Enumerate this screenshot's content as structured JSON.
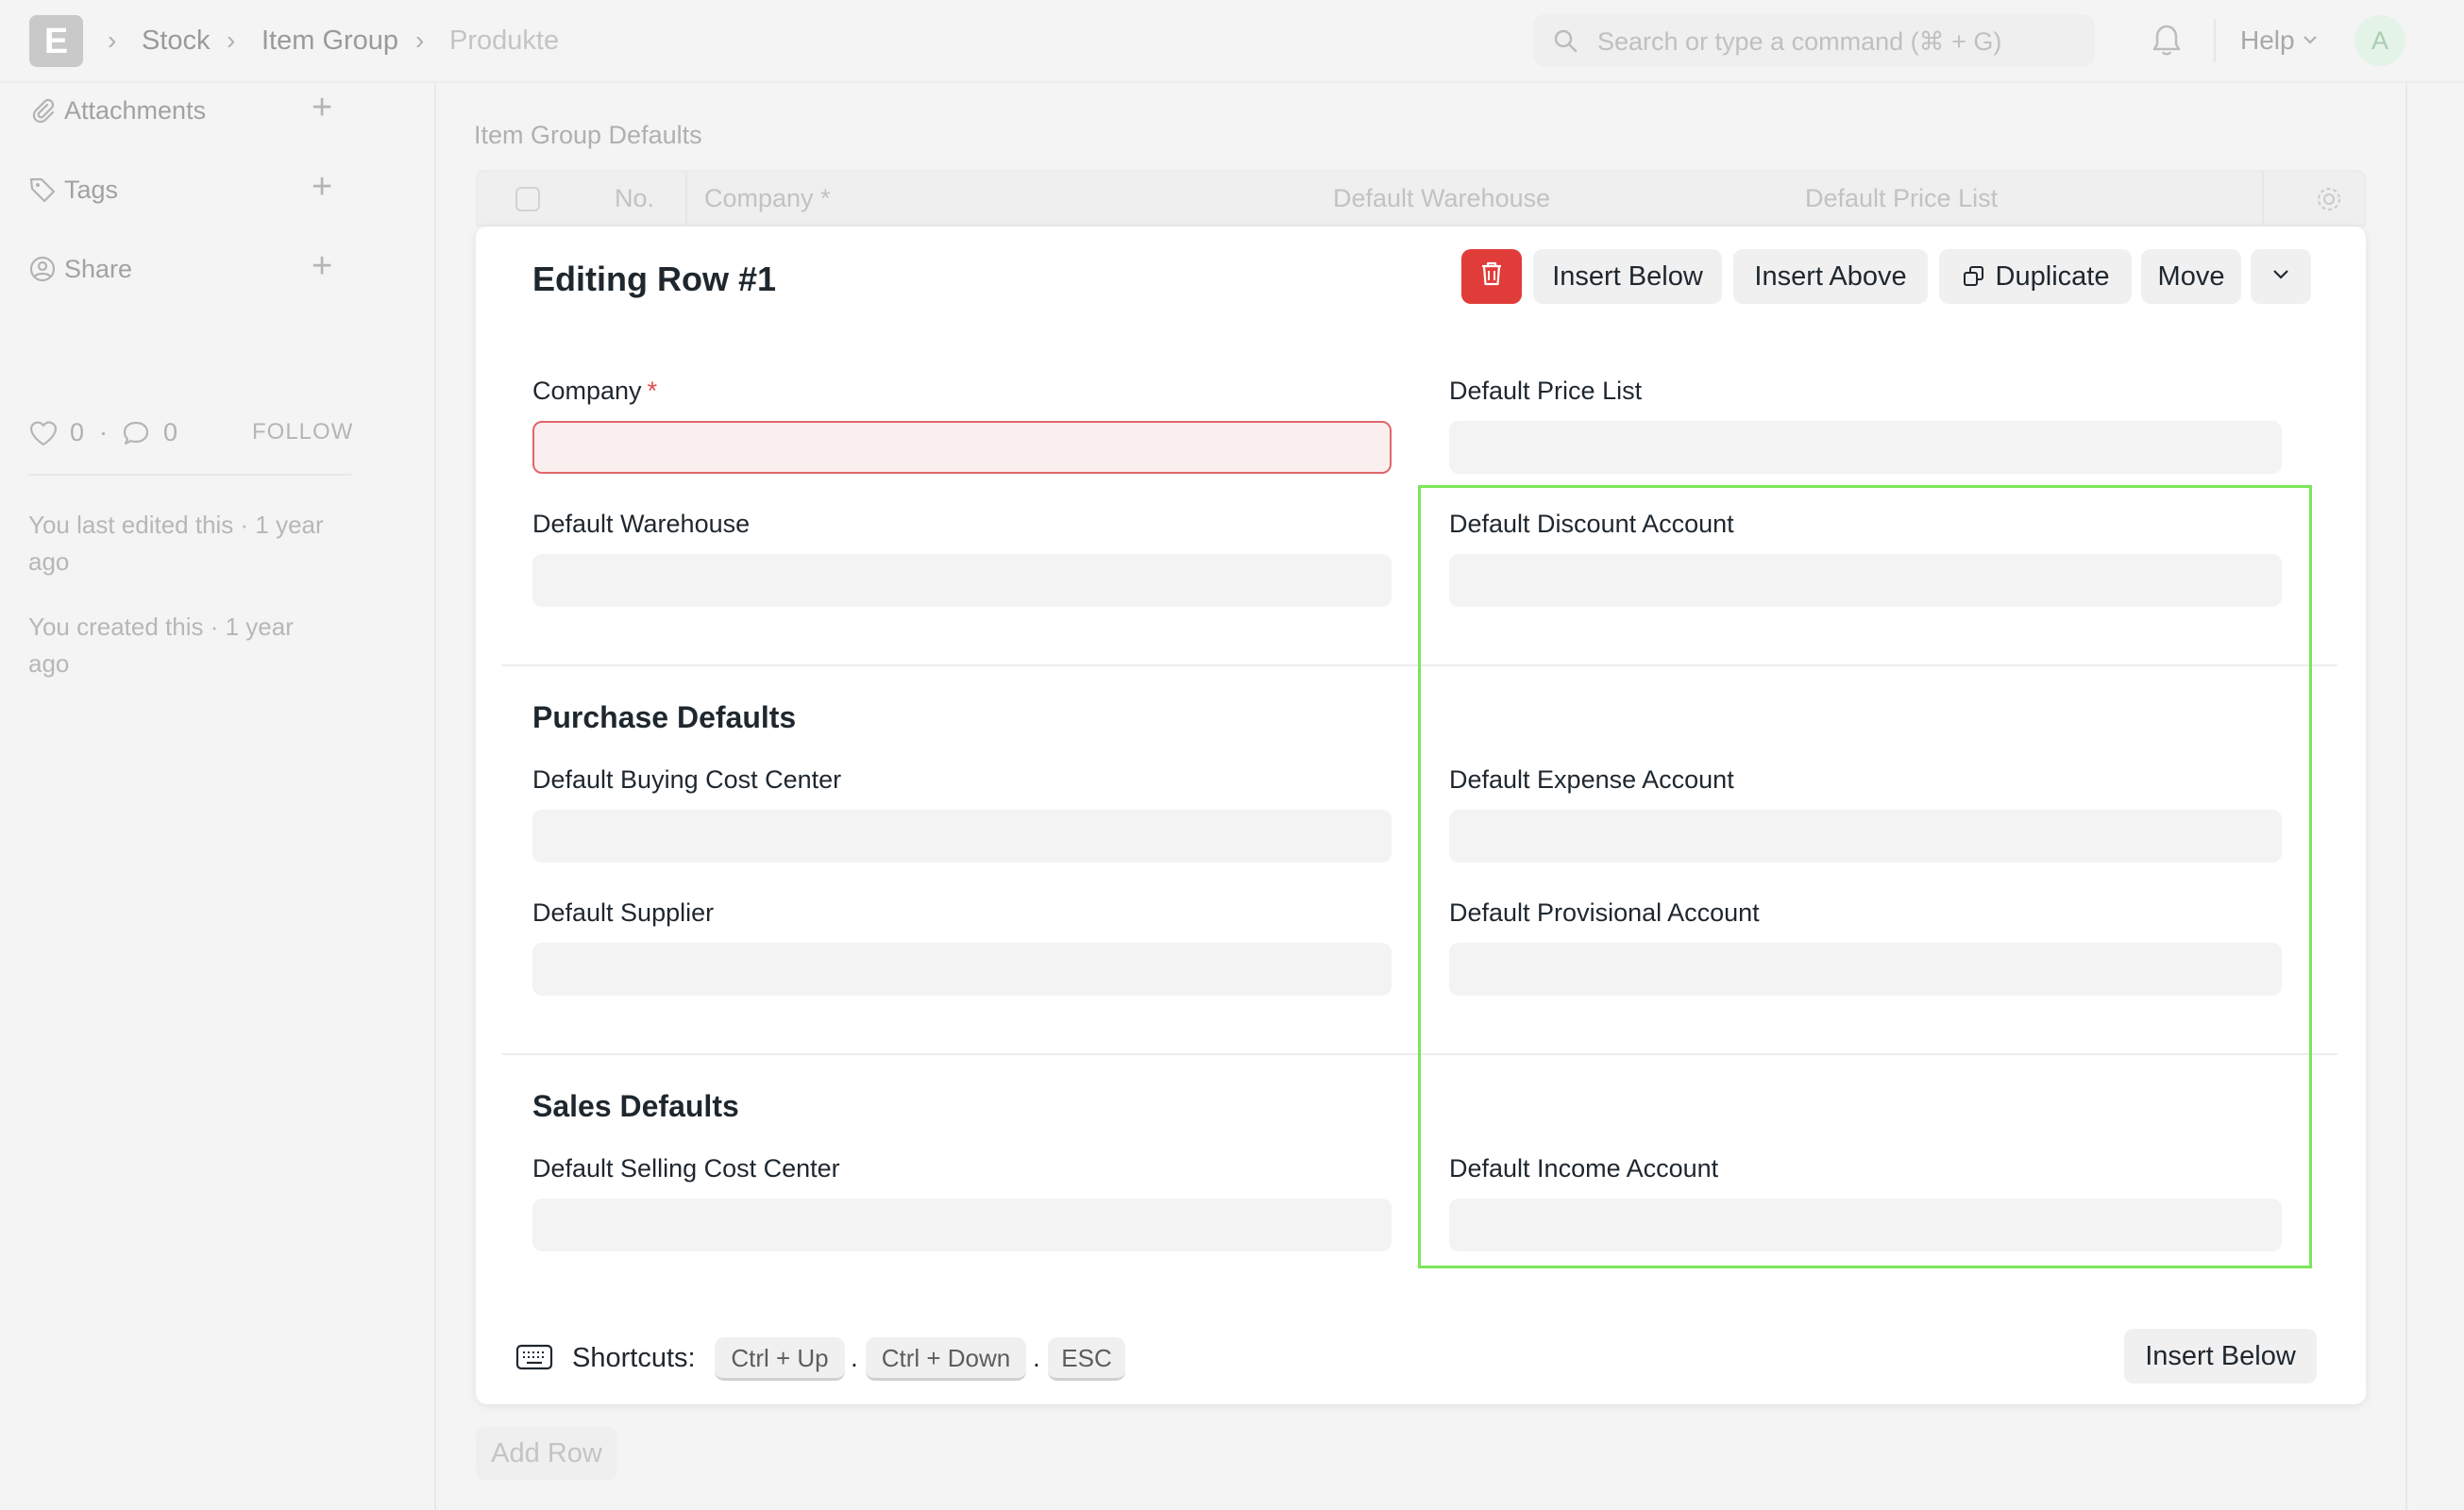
{
  "navbar": {
    "logo_letter": "E",
    "breadcrumbs": [
      "Stock",
      "Item Group",
      "Produkte"
    ],
    "search_placeholder": "Search or type a command (⌘ + G)",
    "help_label": "Help",
    "avatar_letter": "A"
  },
  "sidebar": {
    "items": [
      {
        "label": "Attachments",
        "icon": "paperclip-icon"
      },
      {
        "label": "Tags",
        "icon": "tag-icon"
      },
      {
        "label": "Share",
        "icon": "user-share-icon"
      }
    ],
    "likes": "0",
    "comments": "0",
    "stat_separator": "·",
    "follow_label": "FOLLOW",
    "last_edited": "You last edited this · 1 year ago",
    "created": "You created this · 1 year ago"
  },
  "grid": {
    "section_label": "Item Group Defaults",
    "columns": {
      "no": "No.",
      "company": "Company *",
      "warehouse": "Default Warehouse",
      "price_list": "Default Price List"
    },
    "add_row_label": "Add Row"
  },
  "panel": {
    "title": "Editing Row #1",
    "buttons": {
      "insert_below": "Insert Below",
      "insert_above": "Insert Above",
      "duplicate": "Duplicate",
      "move": "Move"
    },
    "fields": {
      "company": {
        "label": "Company",
        "required_mark": "*",
        "value": ""
      },
      "default_price_list": {
        "label": "Default Price List",
        "value": ""
      },
      "default_warehouse": {
        "label": "Default Warehouse",
        "value": ""
      },
      "default_discount_account": {
        "label": "Default Discount Account",
        "value": ""
      },
      "default_buying_cost_center": {
        "label": "Default Buying Cost Center",
        "value": ""
      },
      "default_expense_account": {
        "label": "Default Expense Account",
        "value": ""
      },
      "default_supplier": {
        "label": "Default Supplier",
        "value": ""
      },
      "default_provisional_account": {
        "label": "Default Provisional Account",
        "value": ""
      },
      "default_selling_cost_center": {
        "label": "Default Selling Cost Center",
        "value": ""
      },
      "default_income_account": {
        "label": "Default Income Account",
        "value": ""
      }
    },
    "sections": {
      "purchase": "Purchase Defaults",
      "sales": "Sales Defaults"
    },
    "shortcuts": {
      "label": "Shortcuts:",
      "keys": [
        "Ctrl + Up",
        "Ctrl + Down",
        "ESC"
      ],
      "separator": "."
    },
    "footer_insert_below": "Insert Below"
  },
  "colors": {
    "danger": "#e03c3a",
    "highlight": "#7be65a",
    "required": "#e24c4c"
  }
}
